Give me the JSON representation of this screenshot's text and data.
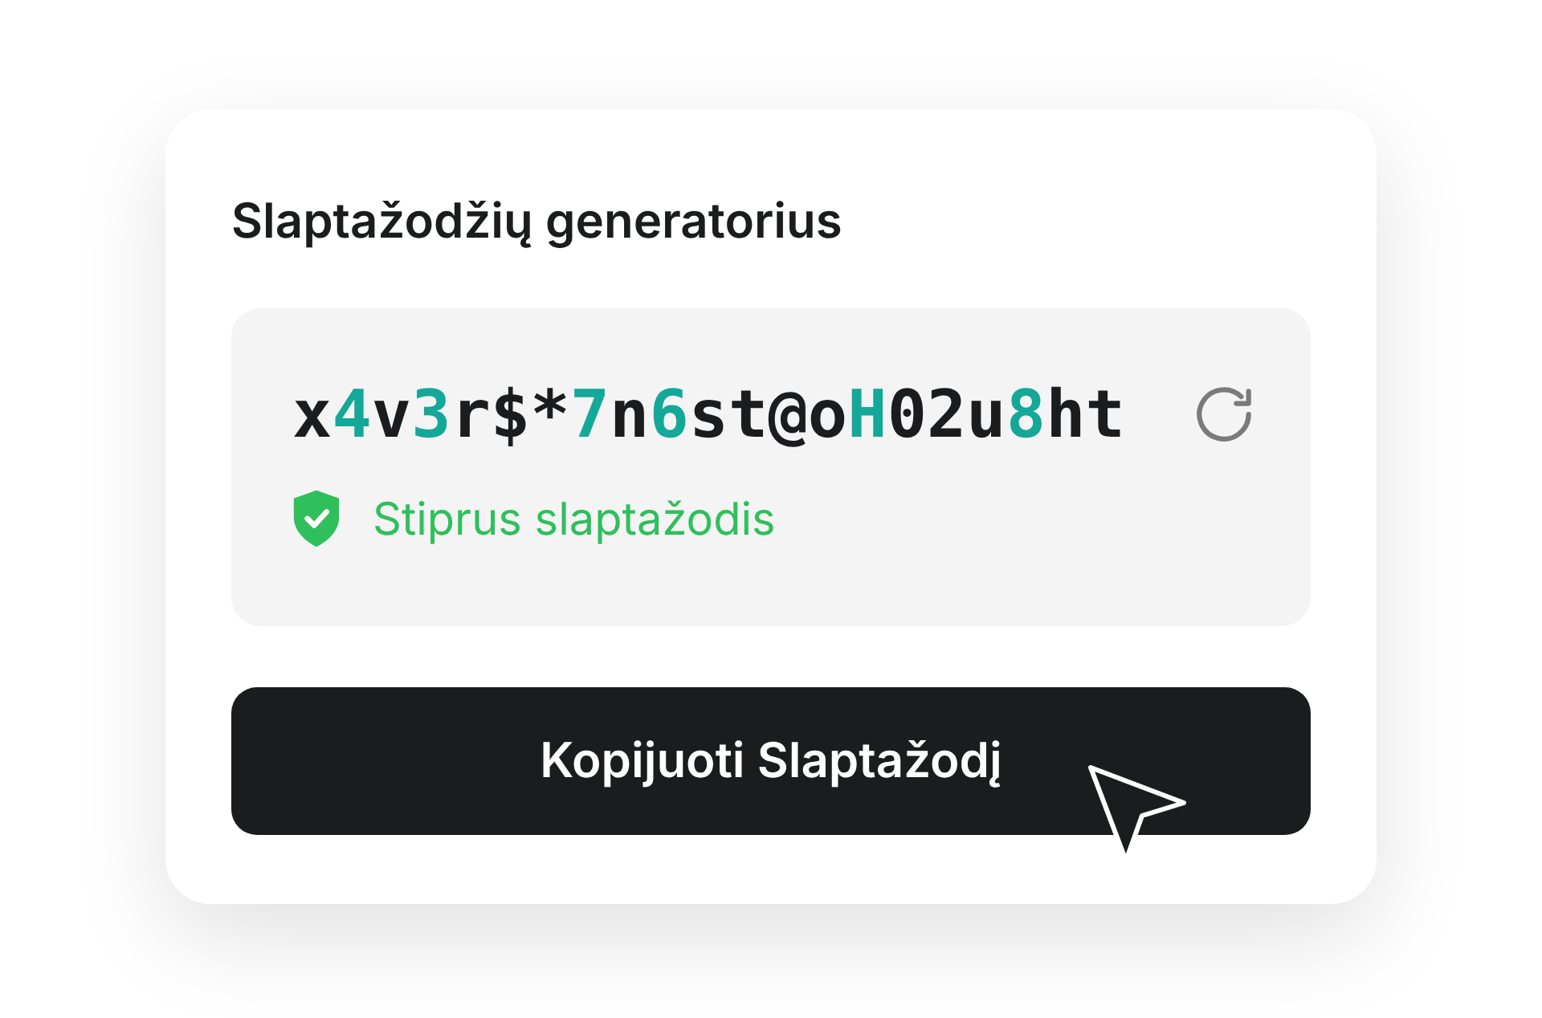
{
  "title": "Slaptažodžių generatorius",
  "password": [
    {
      "text": "x",
      "highlighted": false
    },
    {
      "text": "4",
      "highlighted": true
    },
    {
      "text": "v",
      "highlighted": false
    },
    {
      "text": "3",
      "highlighted": true
    },
    {
      "text": "r$*",
      "highlighted": false
    },
    {
      "text": "7",
      "highlighted": true
    },
    {
      "text": "n",
      "highlighted": false
    },
    {
      "text": "6",
      "highlighted": true
    },
    {
      "text": "st@o",
      "highlighted": false
    },
    {
      "text": "H",
      "highlighted": true
    },
    {
      "text": "02u",
      "highlighted": false
    },
    {
      "text": "8",
      "highlighted": true
    },
    {
      "text": "ht",
      "highlighted": false
    }
  ],
  "strength": {
    "label": "Stiprus slaptažodis",
    "color": "#2fbf5b"
  },
  "copy_button": "Kopijuoti Slaptažodį"
}
